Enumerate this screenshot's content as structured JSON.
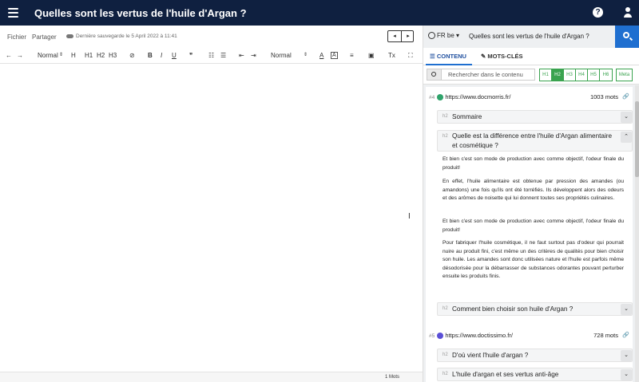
{
  "header": {
    "title": "Quelles sont les vertus de l'huile d'Argan ?",
    "help_label": "?"
  },
  "menu": {
    "fichier": "Fichier",
    "partager": "Partager",
    "save_status": "Dernière sauvegarde le 5 April 2022 à 11:41"
  },
  "nav": {
    "prev": "◂",
    "next": "▸"
  },
  "toolbar": {
    "undo": "←",
    "redo": "→",
    "style": "Normal",
    "h_add": "H",
    "h1": "H1",
    "h2": "H2",
    "h3": "H3",
    "link": "⊘",
    "bold": "B",
    "italic": "I",
    "underline": "U",
    "quote": "❞",
    "ol": "☷",
    "ul": "☰",
    "outdent": "⇤",
    "indent": "⇥",
    "size": "Normal",
    "color": "A",
    "bg": "A",
    "align": "≡",
    "image": "▣",
    "clear": "Tx",
    "fullscreen": "⛶"
  },
  "status": {
    "words": "1 Mots"
  },
  "panel": {
    "lang": "FR be",
    "query": "Quelles sont les vertus de l'huile d'Argan ?",
    "tabs": {
      "content": "CONTENU",
      "keywords": "MOTS-CLÉS"
    },
    "search_placeholder": "Rechercher dans le contenu",
    "hlevels": [
      "H1",
      "H2",
      "H3",
      "H4",
      "H5",
      "H6"
    ],
    "meta": "Meta",
    "results": [
      {
        "num": "#4",
        "url": "https://www.docmorris.fr/",
        "words": "1003 mots",
        "fav_color": "#2fa36b",
        "headings": [
          {
            "tag": "h2",
            "text": "Sommaire",
            "chevron": "⌄"
          },
          {
            "tag": "h2",
            "text": "Quelle est la différence entre l'huile d'Argan alimentaire et cosmétique ?",
            "chevron": "⌃"
          }
        ],
        "paragraphs": [
          "Et bien c'est son mode de production avec comme objectif, l'odeur finale du produit!",
          "En effet, l'huile alimentaire est obtenue par pression des amandes (ou amandons) une fois qu'ils ont été torréfiés. Ils développent alors des odeurs et des arômes de noisette qui lui donnent toutes ses propriétés culinaires.",
          "Et bien c'est son mode de production avec comme objectif, l'odeur finale du produit!",
          "Pour fabriquer l'huile cosmétique, il ne faut surtout pas d'odeur qui pourrait nuire au produit fini, c'est même un des critères de qualités pour bien choisir son huile. Les amandes sont donc utilisées nature et l'huile est parfois même désodorisée pour la débarrasser de substances odorantes pouvant perturber ensuite les produits finis."
        ],
        "last_heading": {
          "tag": "h2",
          "text": "Comment bien choisir son huile d'Argan ?",
          "chevron": "⌄"
        }
      },
      {
        "num": "#5",
        "url": "https://www.doctissimo.fr/",
        "words": "728 mots",
        "fav_color": "#5a4fd6",
        "headings": [
          {
            "tag": "h2",
            "text": "D'où vient l'huile d'argan ?",
            "chevron": "⌄"
          },
          {
            "tag": "h2",
            "text": "L'huile d'argan et ses vertus anti-âge",
            "chevron": "⌄"
          }
        ]
      }
    ]
  }
}
